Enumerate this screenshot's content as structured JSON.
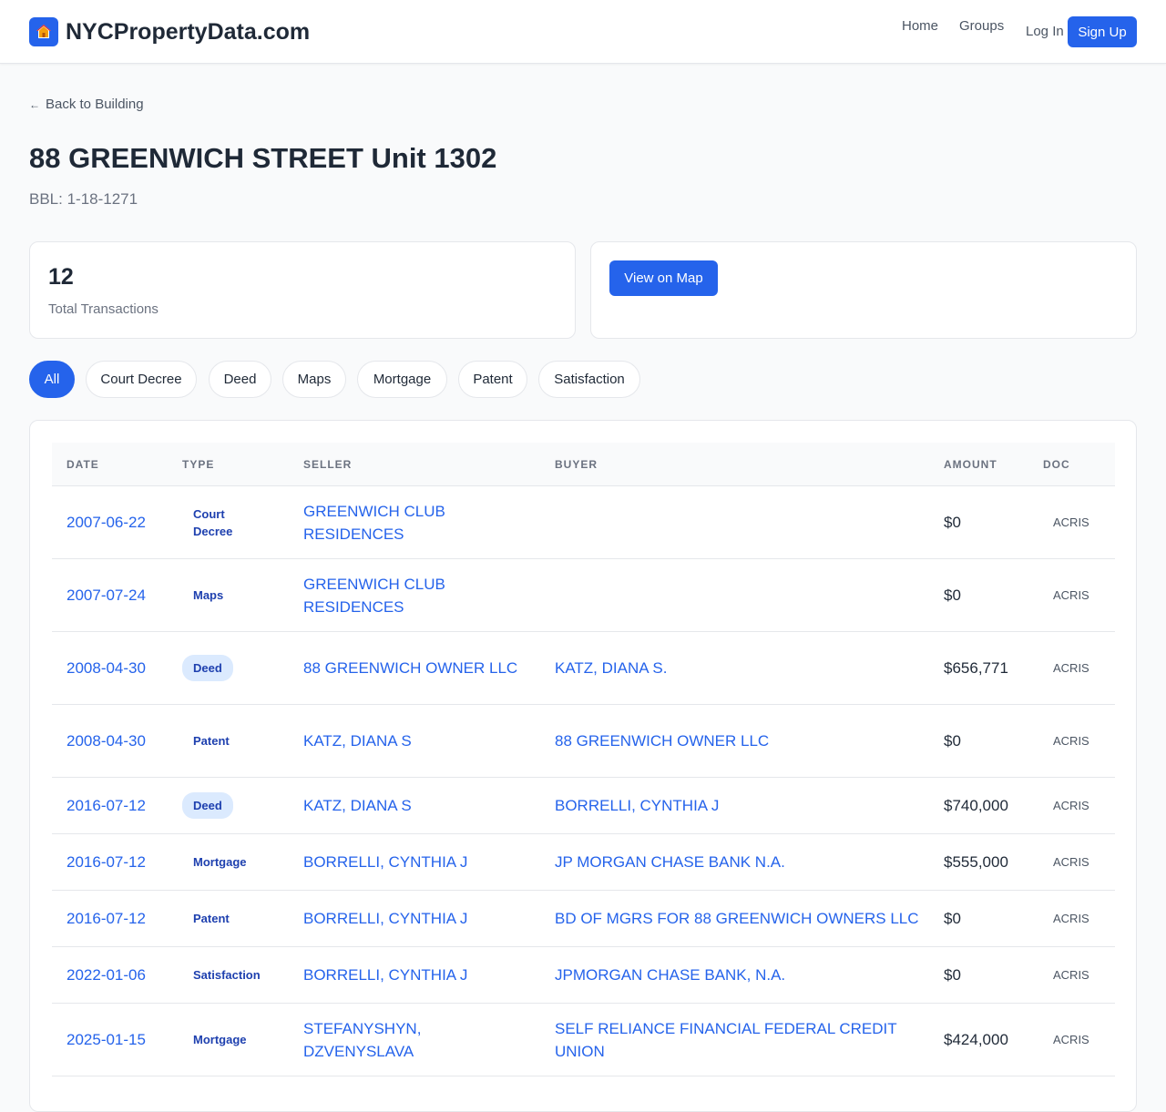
{
  "header": {
    "logo_text": "NYCPropertyData.com",
    "nav": [
      "Home",
      "Groups"
    ],
    "login": "Log In",
    "signup": "Sign Up"
  },
  "back_link": "Back to Building",
  "title": "88 GREENWICH STREET Unit 1302",
  "bbl": "BBL: 1-18-1271",
  "stats": {
    "total_transactions": "12",
    "total_label": "Total Transactions",
    "map_button": "View on Map"
  },
  "filters": [
    "All",
    "Court Decree",
    "Deed",
    "Maps",
    "Mortgage",
    "Patent",
    "Satisfaction"
  ],
  "table": {
    "columns": [
      "DATE",
      "TYPE",
      "SELLER",
      "BUYER",
      "AMOUNT",
      "DOC"
    ],
    "rows": [
      {
        "date": "2007-06-22",
        "type": "Court Decree",
        "seller": "GREENWICH CLUB RESIDENCES",
        "buyer": "",
        "amount": "$0",
        "doc": "ACRIS"
      },
      {
        "date": "2007-07-24",
        "type": "Maps",
        "seller": "GREENWICH CLUB RESIDENCES",
        "buyer": "",
        "amount": "$0",
        "doc": "ACRIS"
      },
      {
        "date": "2008-04-30",
        "type": "Deed",
        "seller": "88 GREENWICH OWNER LLC",
        "buyer": "KATZ, DIANA S.",
        "amount": "$656,771",
        "doc": "ACRIS"
      },
      {
        "date": "2008-04-30",
        "type": "Patent",
        "seller": "KATZ, DIANA S",
        "buyer": "88 GREENWICH OWNER LLC",
        "amount": "$0",
        "doc": "ACRIS"
      },
      {
        "date": "2016-07-12",
        "type": "Deed",
        "seller": "KATZ, DIANA S",
        "buyer": "BORRELLI, CYNTHIA J",
        "amount": "$740,000",
        "doc": "ACRIS"
      },
      {
        "date": "2016-07-12",
        "type": "Mortgage",
        "seller": "BORRELLI, CYNTHIA J",
        "buyer": "JP MORGAN CHASE BANK N.A.",
        "amount": "$555,000",
        "doc": "ACRIS"
      },
      {
        "date": "2016-07-12",
        "type": "Patent",
        "seller": "BORRELLI, CYNTHIA J",
        "buyer": "BD OF MGRS FOR 88 GREENWICH OWNERS LLC",
        "amount": "$0",
        "doc": "ACRIS"
      },
      {
        "date": "2022-01-06",
        "type": "Satisfaction",
        "seller": "BORRELLI, CYNTHIA J",
        "buyer": "JPMORGAN CHASE BANK, N.A.",
        "amount": "$0",
        "doc": "ACRIS"
      },
      {
        "date": "2025-01-15",
        "type": "Mortgage",
        "seller": "STEFANYSHYN, DZVENYSLAVA",
        "buyer": "SELF RELIANCE FINANCIAL FEDERAL CREDIT UNION",
        "amount": "$424,000",
        "doc": "ACRIS"
      }
    ]
  },
  "colors": {
    "accent": "#2563eb",
    "badge_bg": "#dbeafe",
    "badge_text": "#1e40af"
  }
}
